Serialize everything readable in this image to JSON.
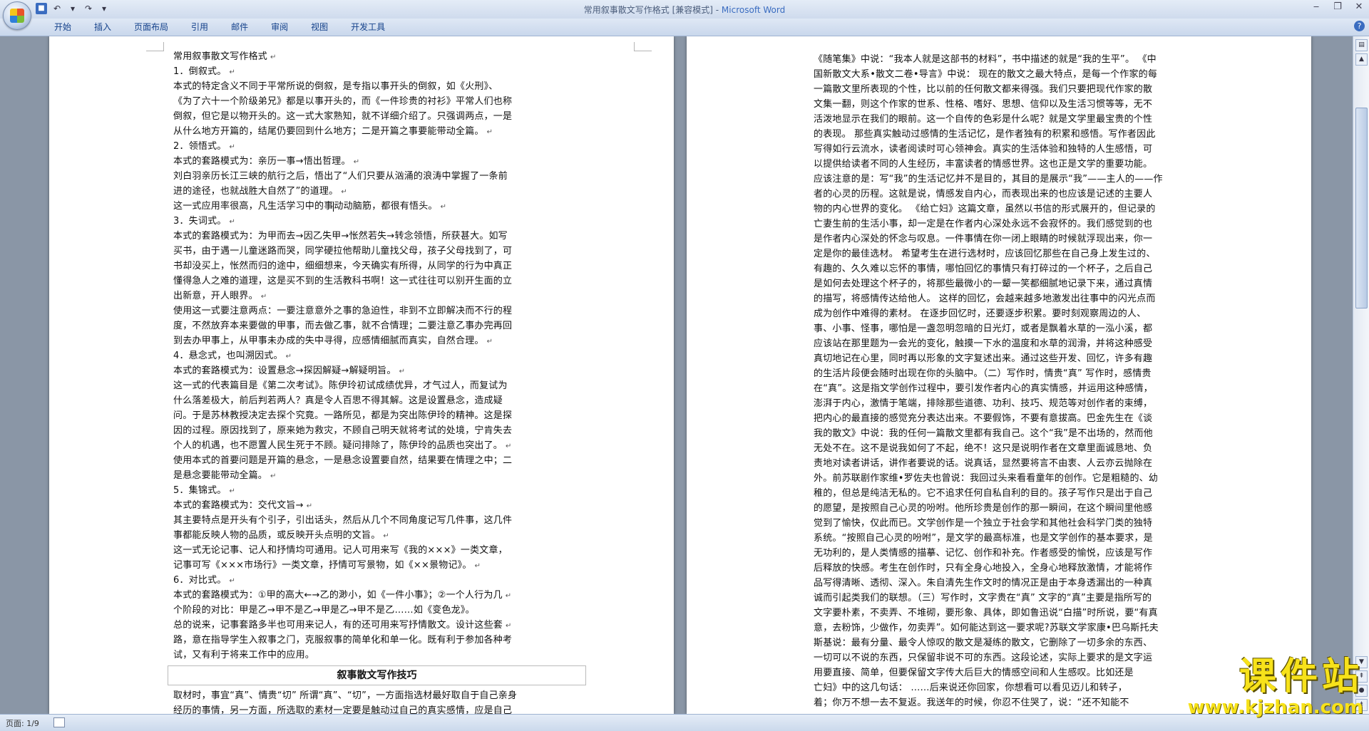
{
  "window": {
    "title": "常用叙事散文写作格式 [兼容模式] - ",
    "app_name": "Microsoft Word"
  },
  "quick_access": {
    "save_icon": "save-icon",
    "undo_icon": "undo-icon",
    "redo_icon": "redo-icon"
  },
  "ribbon": {
    "tabs": [
      {
        "label": "开始"
      },
      {
        "label": "插入"
      },
      {
        "label": "页面布局"
      },
      {
        "label": "引用"
      },
      {
        "label": "邮件"
      },
      {
        "label": "审阅"
      },
      {
        "label": "视图"
      },
      {
        "label": "开发工具"
      }
    ],
    "help": "?"
  },
  "page1": {
    "lines": [
      "常用叙事散文写作格式",
      "1．倒叙式。",
      "本式的特定含义不同于平常所说的倒叙，是专指以事开头的倒叙，如《火刑》、",
      "《为了六十一个阶级弟兄》都是以事开头的，而《一件珍贵的衬衫》平常人们也称",
      "倒叙，但它是以物开头的。这一式大家熟知，就不详细介绍了。只强调两点，一是",
      "从什么地方开篇的，结尾仍要回到什么地方；二是开篇之事要能带动全篇。",
      "2．领悟式。",
      "本式的套路模式为：亲历一事→悟出哲理。",
      "刘白羽亲历长江三峡的航行之后，悟出了“人们只要从汹涌的浪涛中掌握了一条前",
      "进的途径，也就战胜大自然了”的道理。",
      "这一式应用率很高，凡生活学习中的事",
      "动动脑筋，都很有悟头。",
      "3．失词式。",
      "本式的套路模式为：为甲而去→因乙失甲→怅然若失→转念领悟，所获甚大。如写",
      "买书，由于遇一儿童迷路而哭，同学硬拉他帮助儿童找父母，孩子父母找到了，可",
      "书却没买上，怅然而归的途中，细细想来，今天确实有所得，从同学的行为中真正",
      "懂得急人之难的道理，这是买不到的生活教科书啊！这一式往往可以别开生面的立",
      "出新意，开人眼界。",
      "使用这一式要注意两点：一要注意意外之事的急迫性，非到不立即解决而不行的程",
      "度，不然放弃本来要做的甲事，而去做乙事，就不合情理；二要注意乙事办完再回",
      "到去办甲事上，从甲事未办成的失中寻得，应感情细腻而真实，自然合理。",
      "4．悬念式，也叫溯因式。",
      "本式的套路模式为：设置悬念→探因解疑→解疑明旨。",
      "这一式的代表篇目是《第二次考试》。陈伊玲初试成绩优异，才气过人，而复试为",
      "什么落差极大，前后判若两人？真是令人百思不得其解。这是设置悬念，造成疑",
      "问。于是苏林教授决定去探个究竟。一路所见，都是为突出陈伊玲的精神。这是探",
      "因的过程。原因找到了，原来她为救灾，不顾自己明天就将考试的处境，宁肯失去",
      "个人的机遇，也不愿置人民生死于不顾。疑问排除了，陈伊玲的品质也突出了。",
      "使用本式的首要问题是开篇的悬念，一是悬念设置要自然，结果要在情理之中；二",
      "是悬念要能带动全篇。",
      "5．集锦式。",
      "本式的套路模式为：交代文旨→",
      "其主要特点是开头有个引子，引出话头，然后从几个不同角度记写几件事，这几件",
      "事都能反映人物的品质，或反映开头点明的文旨。",
      "这一式无论记事、记人和抒情均可通用。记人可用来写《我的×××》一类文章，",
      "记事可写《×××市场行》一类文章，抒情可写景物，如《××景物记》。",
      "6．对比式。",
      "本式的套路模式为：①甲的高大←→乙的渺小，如《一件小事》；②一个人行为几",
      "个阶段的对比：甲是乙→甲不是乙→甲是乙→甲不是乙……如《变色龙》。",
      "总的说来，记事套路多半也可用来记人，有的还可用来写抒情散文。设计这些套",
      "路，意在指导学生入叙事之门，克服叙事的简单化和单一化。既有利于参加各种考",
      "试，又有利于将来工作中的应用。"
    ],
    "heading": "叙事散文写作技巧",
    "after_heading": [
      "取材时，事宜“真”、情贵“切” 所谓“真”、“切”，一方面指选材最好取自于自己亲身",
      "经历的事情，另一方面，所选取的素材一定要是触动过自己的真实感情，应是自己"
    ]
  },
  "page2": {
    "lines": [
      "《随笔集》中说：“我本人就是这部书的材料”，书中描述的就是“我的生平”。 《中",
      "国新散文大系•散文二卷•导言》中说： 现在的散文之最大特点，是每一个作家的每",
      "一篇散文里所表现的个性，比以前的任何散文都来得强。我们只要把现代作家的散",
      "文集一翻，则这个作家的世系、性格、嗜好、思想、信仰以及生活习惯等等，无不",
      "活泼地显示在我们的眼前。这一个自传的色彩是什么呢？就是文学里最宝贵的个性",
      "的表现。 那些真实触动过感情的生活记忆，是作者独有的积累和感悟。写作者因此",
      "写得如行云流水，读者阅读时可心领神会。真实的生活体验和独特的人生感悟，可",
      "以提供给读者不同的人生经历，丰富读者的情感世界。这也正是文学的重要功能。",
      "应该注意的是：写“我”的生活记忆并不是目的，其目的是展示“我”——主人的——作",
      "者的心灵的历程。这就是说，情感发自内心，而表现出来的也应该是记述的主要人",
      "物的内心世界的变化。 《给亡妇》这篇文章，虽然以书信的形式展开的，但记录的",
      "亡妻生前的生活小事，却一定是在作者内心深处永远不会寂怀的。我们感觉到的也",
      "是作者内心深处的怀念与叹息。一件事情在你一闭上眼睛的时候就浮现出来，你一",
      "定是你的最佳选材。 希望考生在进行选材时，应该回忆那些在自己身上发生过的、",
      "有趣的、久久难以忘怀的事情，哪怕回忆的事情只有打碎过的一个杯子，之后自己",
      "是如何去处理这个杯子的，将那些最微小的一颦一笑都细腻地记录下来，通过真情",
      "的描写，将感情传达给他人。 这样的回忆，会越来越多地激发出往事中的闪光点而",
      "成为创作中难得的素材。 在逐步回忆时，还要逐步积累。要时刻观察周边的人、",
      "事、小事、怪事，哪怕是一盏忽明忽暗的日光灯，或者是飘着水草的一泓小溪，都",
      "应该站在那里题为一会光的变化，触摸一下水的温度和水草的润滑，并将这种感受",
      "真切地记在心里，同时再以形象的文字复述出来。通过这些开发、回忆，许多有趣",
      "的生活片段便会随时出现在你的头脑中。（二）写作时，情贵“真” 写作时，感情贵",
      "在“真”。这是指文学创作过程中，要引发作者内心的真实情感，并运用这种感情，",
      "澎湃于内心，激情于笔端，排除那些道德、功利、技巧、规范等对创作者的束缚，",
      "把内心的最直接的感觉充分表达出来。不要假饰，不要有意拔高。巴金先生在《谈",
      "我的散文》中说：我的任何一篇散文里都有我自己。这个“我”是不出场的，然而他",
      "无处不在。这不是说我如何了不起，绝不！这只是说明作者在文章里面诚恳地、负",
      "责地对读者讲话，讲作者要说的话。说真话，显然要将言不由衷、人云亦云抛除在",
      "外。前苏联剧作家维•罗佐夫也曾说：我回过头来看看童年的创作。它是粗糙的、幼",
      "稚的，但总是纯洁无私的。它不追求任何自私自利的目的。孩子写作只是出于自己",
      "的愿望，是按照自己心灵的吩咐。他所珍贵是创作的那一瞬间，在这个瞬间里他感",
      "觉到了愉快，仅此而已。文学创作是一个独立于社会学和其他社会科学门类的独特",
      "系统。“按照自己心灵的吩咐”，是文学的最高标准，也是文学创作的基本要求，是",
      "无功利的，是人类情感的描摹、记忆、创作和补充。作者感受的愉悦，应该是写作",
      "后释放的快感。考生在创作时，只有全身心地投入，全身心地释放激情，才能将作",
      "品写得清晰、透彻、深入。朱自清先生作文时的情况正是由于本身透漏出的一种真",
      "诚而引起类我们的联想。（三）写作时，文字贵在“真” 文字的“真”主要是指所写的",
      "文字要朴素，不卖弄、不堆砌，要形象、具体，即如鲁迅说“白描”时所说，要“有真",
      "意，去粉饰，少做作，勿卖弄”。如何能达到这一要求呢?苏联文学家康•巴乌斯托夫",
      "斯基说：最有分量、最令人惊叹的散文是凝练的散文，它删除了一切多余的东西、",
      "一切可以不说的东西，只保留非说不可的东西。这段论述，实际上要求的是文字运",
      "用要直接、简单，但要保留文字传大后巨大的情感空间和人生感叹。比如还是",
      "亡妇》中的这几句话： ……后来说还你回家，你想看可以看见迈儿和转子，",
      "着；你万不想一去不复返。我送年的时候，你忍不住哭了，说：“还不知能不"
    ]
  },
  "status": {
    "page": "页面: 1/9"
  },
  "watermark": {
    "title": "课件站",
    "url": "www.kjzhan.com"
  }
}
